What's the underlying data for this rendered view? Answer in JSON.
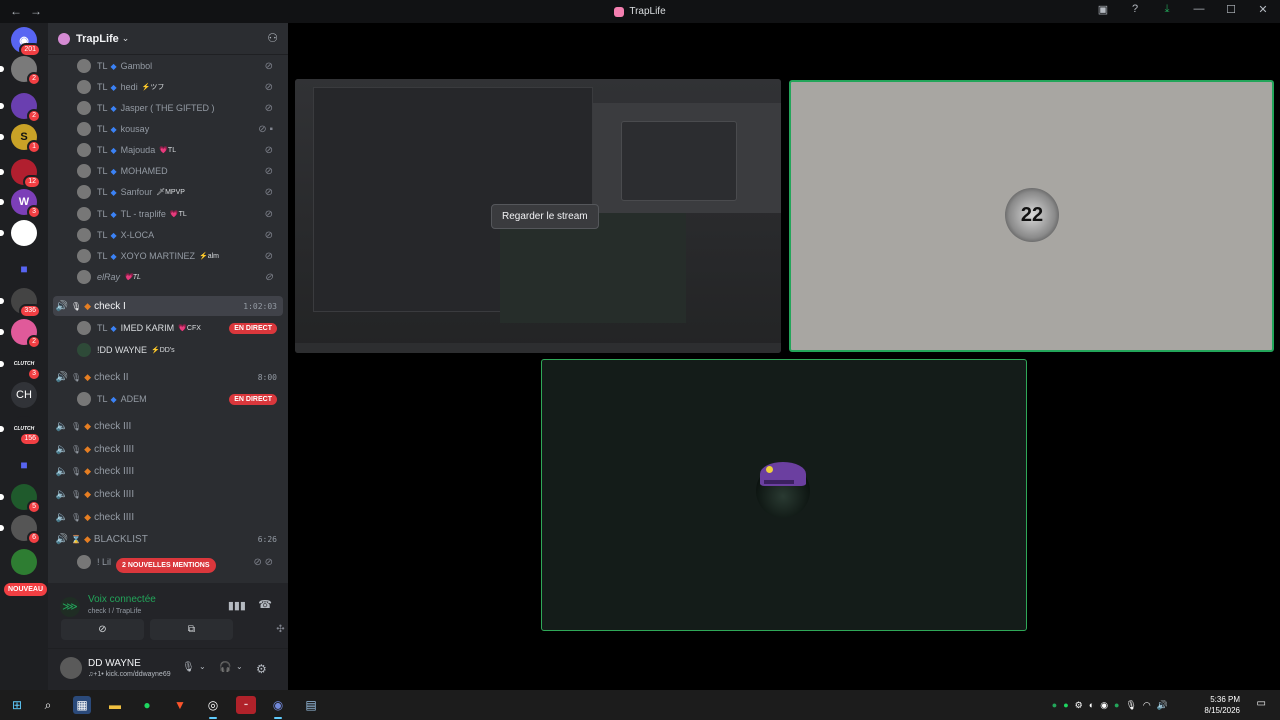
{
  "window": {
    "title": "TrapLife",
    "back": "←",
    "forward": "→",
    "controls": [
      "▣",
      "?",
      "⤓",
      "—",
      "☐",
      "✕"
    ]
  },
  "guilds": [
    {
      "label": "",
      "badge": "201",
      "color": "#5865f2",
      "icon": "discord-home-icon"
    },
    {
      "label": "",
      "badge": "2",
      "color": "#7a7a7a"
    },
    {
      "label": "",
      "badge": "2",
      "color": "#6a3fb0"
    },
    {
      "label": "S",
      "badge": "1",
      "color": "#c9a227"
    },
    {
      "label": "",
      "badge": "12",
      "color": "#b11f2f"
    },
    {
      "label": "W",
      "badge": "3",
      "color": "#7c3fb8"
    },
    {
      "label": "",
      "badge": "",
      "color": "#ffffff"
    },
    {
      "label": "",
      "badge": "336",
      "color": "#444444"
    },
    {
      "label": "",
      "badge": "2",
      "color": "#e05a9a"
    },
    {
      "label": "CLUTCH",
      "badge": "3",
      "color": "#1e1f22"
    },
    {
      "label": "CH",
      "badge": "",
      "color": "#313338"
    },
    {
      "label": "CLUTCH",
      "badge": "156",
      "color": "#1e1f22"
    },
    {
      "label": "",
      "badge": "5",
      "color": "#1f5a2c"
    },
    {
      "label": "",
      "badge": "6",
      "color": "#555555"
    },
    {
      "label": "",
      "badge": "",
      "color": "#2e7d32"
    }
  ],
  "nouveau": "NOUVEAU",
  "server": {
    "name": "TrapLife",
    "chevron": "⌄"
  },
  "members_top": [
    {
      "tag": "TL",
      "name": "Gambol",
      "extra": ""
    },
    {
      "tag": "TL",
      "name": "hedi",
      "extra": "⚡ツフ"
    },
    {
      "tag": "TL",
      "name": "Jasper ( THE GIFTED )",
      "extra": ""
    },
    {
      "tag": "TL",
      "name": "kousay",
      "extra": ""
    },
    {
      "tag": "TL",
      "name": "Majouda",
      "extra": "💗TL"
    },
    {
      "tag": "TL",
      "name": "MOHAMED",
      "extra": ""
    },
    {
      "tag": "TL",
      "name": "Sanfour",
      "extra": "🗡MPVP"
    },
    {
      "tag": "TL",
      "name": "TL - traplife",
      "extra": "💗TL"
    },
    {
      "tag": "TL",
      "name": "X-LOCA",
      "extra": ""
    },
    {
      "tag": "TL",
      "name": "XOYO MARTINEZ",
      "extra": "⚡alm"
    },
    {
      "tag": "",
      "name": "elRay",
      "extra": "💗TL"
    }
  ],
  "voice": {
    "check1": {
      "name": "check I",
      "timer": "1:02:03"
    },
    "check1_members": [
      {
        "tag": "TL",
        "name": "IMED KARIM",
        "extra": "💗CFX",
        "live": "EN DIRECT"
      },
      {
        "tag": "",
        "name": "!DD WAYNE",
        "extra": "⚡DD's",
        "live": ""
      }
    ],
    "check2": {
      "name": "check II",
      "timer": "8:00"
    },
    "check2_members": [
      {
        "tag": "TL",
        "name": "ADEM",
        "extra": "",
        "live": "EN DIRECT"
      }
    ],
    "others": [
      {
        "name": "check III"
      },
      {
        "name": "check IIII"
      },
      {
        "name": "check IIII"
      },
      {
        "name": "check IIII"
      },
      {
        "name": "check IIII"
      }
    ],
    "blacklist": {
      "name": "BLACKLIST",
      "timer": "6:26"
    },
    "blacklist_member": {
      "name": "! Lil"
    }
  },
  "mentions": "2 NOUVELLES MENTIONS",
  "rtc": {
    "title": "Voix connectée",
    "subtitle": "check I / TrapLife"
  },
  "user": {
    "name": "DD WAYNE",
    "status": "♫+1• kick.com/ddwayne69"
  },
  "stage": {
    "watch_label": "Regarder le stream",
    "jersey": "22"
  },
  "tray": {
    "time": "5:36 PM",
    "date": "8/15/2026"
  }
}
